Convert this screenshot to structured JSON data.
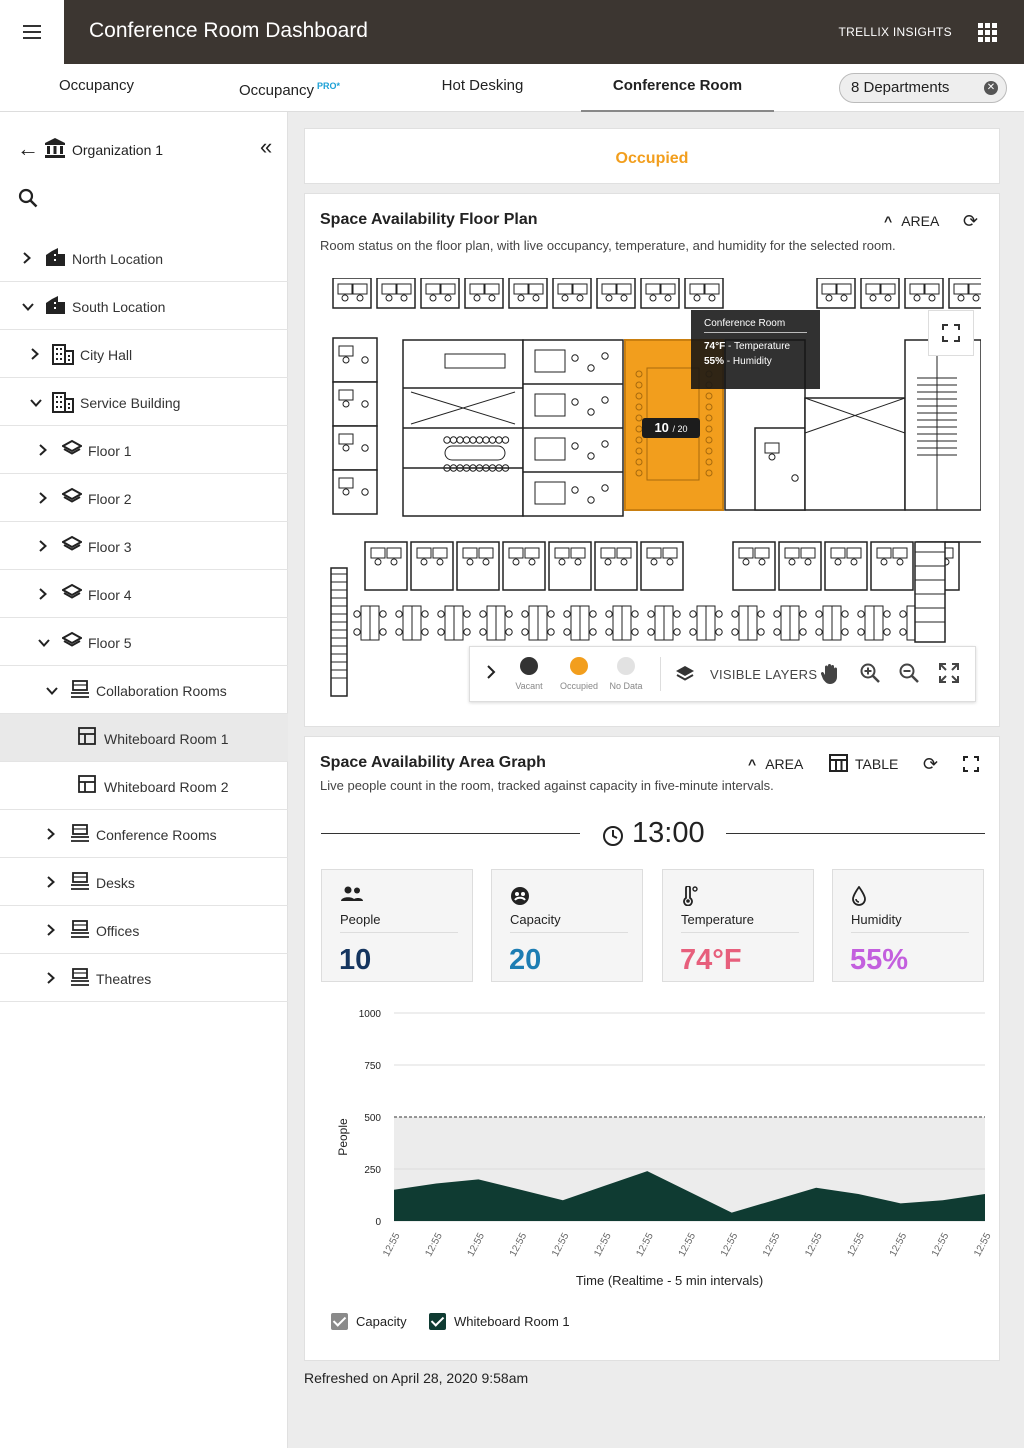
{
  "header": {
    "title": "Conference Room Dashboard",
    "brand": "TRELLIX INSIGHTS"
  },
  "tabs": [
    {
      "label": "Occupancy",
      "badge": ""
    },
    {
      "label": "Occupancy",
      "badge": "PRO*"
    },
    {
      "label": "Hot Desking",
      "badge": ""
    },
    {
      "label": "Conference Room",
      "badge": "",
      "active": true
    }
  ],
  "department_filter": {
    "label": "8 Departments"
  },
  "sidebar": {
    "organization": "Organization 1",
    "tree": [
      {
        "label": "North Location",
        "level": 0,
        "icon": "location",
        "state": "collapsed"
      },
      {
        "label": "South Location",
        "level": 0,
        "icon": "location",
        "state": "expanded"
      },
      {
        "label": "City Hall",
        "level": 1,
        "icon": "building",
        "state": "collapsed"
      },
      {
        "label": "Service Building",
        "level": 1,
        "icon": "building",
        "state": "expanded"
      },
      {
        "label": "Floor 1",
        "level": 2,
        "icon": "floor",
        "state": "collapsed"
      },
      {
        "label": "Floor 2",
        "level": 2,
        "icon": "floor",
        "state": "collapsed"
      },
      {
        "label": "Floor 3",
        "level": 2,
        "icon": "floor",
        "state": "collapsed"
      },
      {
        "label": "Floor 4",
        "level": 2,
        "icon": "floor",
        "state": "collapsed"
      },
      {
        "label": "Floor 5",
        "level": 2,
        "icon": "floor",
        "state": "expanded"
      },
      {
        "label": "Collaboration Rooms",
        "level": 3,
        "icon": "room-group",
        "state": "expanded"
      },
      {
        "label": "Whiteboard Room 1",
        "level": 4,
        "icon": "room",
        "state": "leaf",
        "selected": true
      },
      {
        "label": "Whiteboard Room 2",
        "level": 4,
        "icon": "room",
        "state": "leaf"
      },
      {
        "label": "Conference Rooms",
        "level": 3,
        "icon": "room-group",
        "state": "collapsed"
      },
      {
        "label": "Desks",
        "level": 3,
        "icon": "room-group",
        "state": "collapsed"
      },
      {
        "label": "Offices",
        "level": 3,
        "icon": "room-group",
        "state": "collapsed"
      },
      {
        "label": "Theatres",
        "level": 3,
        "icon": "room-group",
        "state": "collapsed"
      }
    ]
  },
  "status": {
    "label": "Occupied",
    "color": "#f29e1d"
  },
  "floor_plan": {
    "title": "Space Availability Floor Plan",
    "subtitle": "Room status on the floor plan, with live occupancy, temperature, and humidity for the selected room.",
    "area_label": "AREA",
    "tooltip": {
      "title": "Conference Room",
      "temp_value": "74°F",
      "temp_label": "- Temperature",
      "humidity_value": "55%",
      "humidity_label": "- Humidity"
    },
    "room_count": "10",
    "room_capacity": "/ 20",
    "legend": [
      {
        "label": "Vacant",
        "color": "#333333"
      },
      {
        "label": "Occupied",
        "color": "#f29e1d"
      },
      {
        "label": "No Data",
        "color": "#e2e2e2"
      }
    ],
    "layers_label": "VISIBLE LAYERS"
  },
  "area_graph": {
    "title": "Space Availability Area Graph",
    "subtitle": "Live people count in the room, tracked against capacity in five-minute intervals.",
    "area_label": "AREA",
    "table_label": "TABLE",
    "time": "13:00",
    "stats": [
      {
        "label": "People",
        "value": "10",
        "color": "#15355f",
        "icon": "people-icon"
      },
      {
        "label": "Capacity",
        "value": "20",
        "color": "#1d7db3",
        "icon": "capacity-icon"
      },
      {
        "label": "Temperature",
        "value": "74°F",
        "color": "#e75f7c",
        "icon": "thermometer-icon"
      },
      {
        "label": "Humidity",
        "value": "55%",
        "color": "#c35fde",
        "icon": "humidity-icon"
      }
    ],
    "legend": [
      {
        "label": "Capacity",
        "color": "#8a8a8a"
      },
      {
        "label": "Whiteboard Room 1",
        "color": "#0f3b32"
      }
    ]
  },
  "chart_data": {
    "type": "area",
    "xlabel": "Time (Realtime - 5 min intervals)",
    "ylabel": "People",
    "ylim": [
      0,
      1000
    ],
    "yticks": [
      0,
      250,
      500,
      750,
      1000
    ],
    "x": [
      "12:55",
      "12:55",
      "12:55",
      "12:55",
      "12:55",
      "12:55",
      "12:55",
      "12:55",
      "12:55",
      "12:55",
      "12:55",
      "12:55",
      "12:55",
      "12:55",
      "12:55"
    ],
    "capacity_line": 500,
    "series": [
      {
        "name": "Whiteboard Room 1",
        "values": [
          150,
          180,
          200,
          150,
          100,
          170,
          240,
          140,
          40,
          100,
          160,
          130,
          85,
          100,
          130
        ],
        "color": "#0f3b32"
      },
      {
        "name": "Capacity",
        "values": [
          500,
          500,
          500,
          500,
          500,
          500,
          500,
          500,
          500,
          500,
          500,
          500,
          500,
          500,
          500
        ],
        "color": "#8a8a8a"
      }
    ]
  },
  "refreshed": "Refreshed on April 28, 2020  9:58am"
}
